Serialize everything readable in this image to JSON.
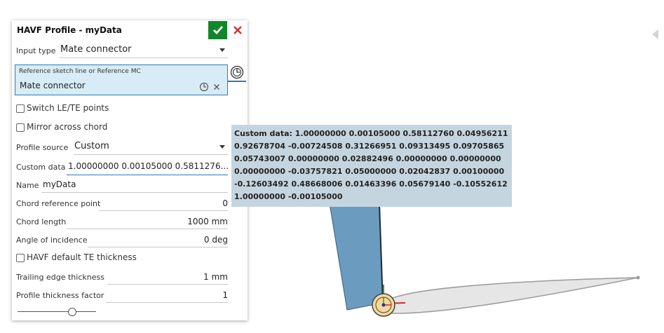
{
  "dialog": {
    "title": "HAVF Profile - myData",
    "input_type": {
      "label": "Input type",
      "value": "Mate connector"
    },
    "reference": {
      "label": "Reference sketch line or Reference MC",
      "value": "Mate connector"
    },
    "switch_le_te": {
      "label": "Switch LE/TE points",
      "checked": false
    },
    "mirror_chord": {
      "label": "Mirror across chord",
      "checked": false
    },
    "profile_source": {
      "label": "Profile source",
      "value": "Custom"
    },
    "custom_data": {
      "label": "Custom data",
      "value": "1.00000000 0.00105000 0.5811276..."
    },
    "name": {
      "label": "Name",
      "value": "myData"
    },
    "chord_ref_point": {
      "label": "Chord reference point",
      "value": "0"
    },
    "chord_length": {
      "label": "Chord length",
      "value": "1000 mm"
    },
    "angle_incidence": {
      "label": "Angle of incidence",
      "value": "0 deg"
    },
    "havf_default_te": {
      "label": "HAVF default TE thickness",
      "checked": false
    },
    "te_thickness": {
      "label": "Trailing edge thickness",
      "value": "1 mm"
    },
    "thickness_factor": {
      "label": "Profile thickness factor",
      "value": "1"
    },
    "slider_position": 0.7
  },
  "tooltip": {
    "lines": [
      "Custom data: 1.00000000 0.00105000 0.58112760 0.04956211",
      "0.92678704 -0.00724508 0.31266951 0.09313495 0.09705865",
      "0.05743007 0.00000000 0.02882496 0.00000000 0.00000000",
      "0.00000000 -0.03757821 0.05000000 0.02042837 0.00100000",
      "-0.12603492 0.48668006 0.01463396 0.05679140 -0.10552612",
      "1.00000000 -0.00105000"
    ]
  },
  "colors": {
    "accent": "#2e7ab8",
    "ok_green": "#12862c",
    "close_red": "#d0312d",
    "tooltip_bg": "#c5d5e0",
    "selection_bg": "#d7ecf7",
    "part_blue": "#6b9cc0"
  },
  "icons": [
    "checkmark-icon",
    "close-icon",
    "clock-select-icon",
    "clear-icon",
    "caret-down-icon",
    "mate-connector-icon"
  ]
}
